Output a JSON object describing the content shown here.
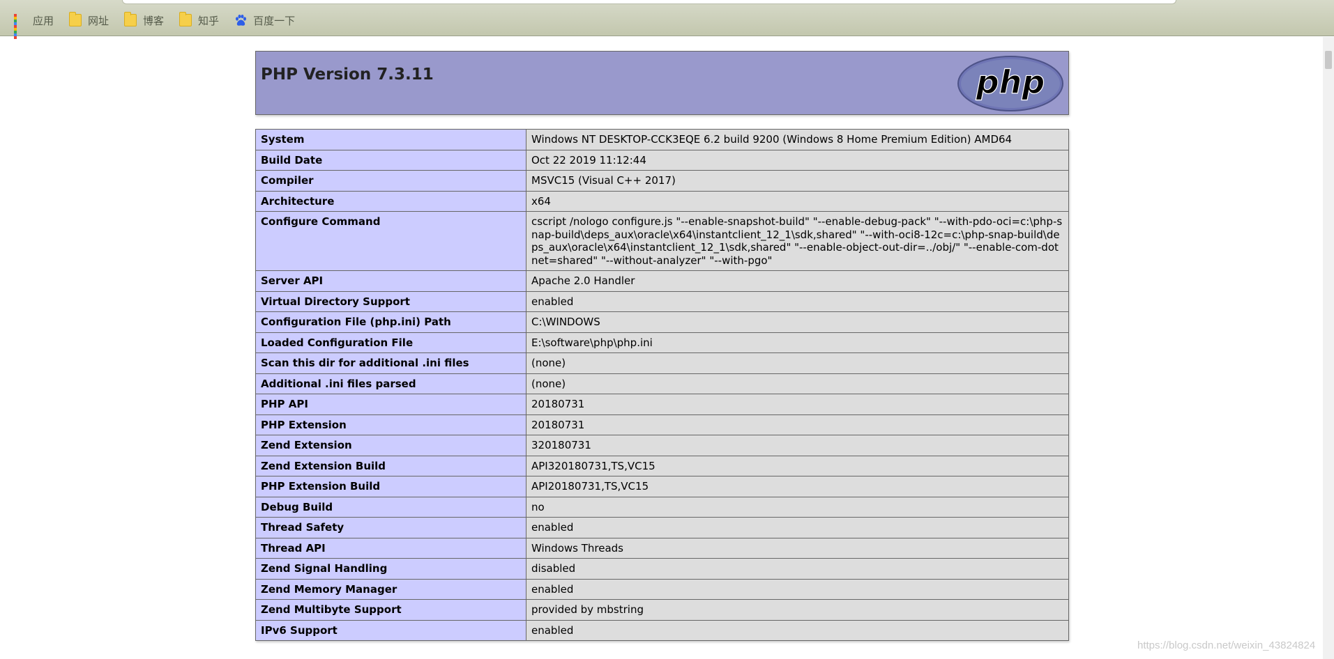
{
  "browser": {
    "bookmarks": [
      {
        "label": "应用",
        "icon": "apps-grid-icon"
      },
      {
        "label": "网址",
        "icon": "folder-icon"
      },
      {
        "label": "博客",
        "icon": "folder-icon"
      },
      {
        "label": "知乎",
        "icon": "folder-icon"
      },
      {
        "label": "百度一下",
        "icon": "baidu-paw-icon"
      }
    ]
  },
  "phpinfo": {
    "title": "PHP Version 7.3.11",
    "logo_text": "php",
    "colors": {
      "header": "#9999cc",
      "key_cell": "#ccccff",
      "value_cell": "#dddddd"
    },
    "rows": [
      {
        "key": "System",
        "value": "Windows NT DESKTOP-CCK3EQE 6.2 build 9200 (Windows 8 Home Premium Edition) AMD64"
      },
      {
        "key": "Build Date",
        "value": "Oct 22 2019 11:12:44"
      },
      {
        "key": "Compiler",
        "value": "MSVC15 (Visual C++ 2017)"
      },
      {
        "key": "Architecture",
        "value": "x64"
      },
      {
        "key": "Configure Command",
        "value": "cscript /nologo configure.js \"--enable-snapshot-build\" \"--enable-debug-pack\" \"--with-pdo-oci=c:\\php-snap-build\\deps_aux\\oracle\\x64\\instantclient_12_1\\sdk,shared\" \"--with-oci8-12c=c:\\php-snap-build\\deps_aux\\oracle\\x64\\instantclient_12_1\\sdk,shared\" \"--enable-object-out-dir=../obj/\" \"--enable-com-dotnet=shared\" \"--without-analyzer\" \"--with-pgo\""
      },
      {
        "key": "Server API",
        "value": "Apache 2.0 Handler"
      },
      {
        "key": "Virtual Directory Support",
        "value": "enabled"
      },
      {
        "key": "Configuration File (php.ini) Path",
        "value": "C:\\WINDOWS"
      },
      {
        "key": "Loaded Configuration File",
        "value": "E:\\software\\php\\php.ini"
      },
      {
        "key": "Scan this dir for additional .ini files",
        "value": "(none)"
      },
      {
        "key": "Additional .ini files parsed",
        "value": "(none)"
      },
      {
        "key": "PHP API",
        "value": "20180731"
      },
      {
        "key": "PHP Extension",
        "value": "20180731"
      },
      {
        "key": "Zend Extension",
        "value": "320180731"
      },
      {
        "key": "Zend Extension Build",
        "value": "API320180731,TS,VC15"
      },
      {
        "key": "PHP Extension Build",
        "value": "API20180731,TS,VC15"
      },
      {
        "key": "Debug Build",
        "value": "no"
      },
      {
        "key": "Thread Safety",
        "value": "enabled"
      },
      {
        "key": "Thread API",
        "value": "Windows Threads"
      },
      {
        "key": "Zend Signal Handling",
        "value": "disabled"
      },
      {
        "key": "Zend Memory Manager",
        "value": "enabled"
      },
      {
        "key": "Zend Multibyte Support",
        "value": "provided by mbstring"
      },
      {
        "key": "IPv6 Support",
        "value": "enabled"
      }
    ]
  },
  "watermark": "https://blog.csdn.net/weixin_43824824"
}
